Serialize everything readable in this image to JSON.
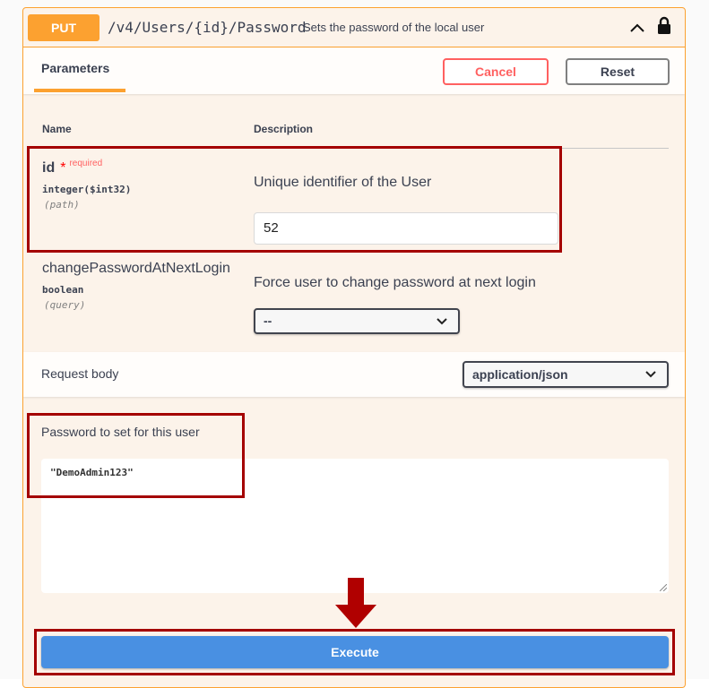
{
  "operation": {
    "method": "PUT",
    "path": "/v4/Users/{id}/Password",
    "summary": "Sets the password of the local user"
  },
  "tabs": {
    "parameters": "Parameters"
  },
  "buttons": {
    "cancel": "Cancel",
    "reset": "Reset",
    "execute": "Execute"
  },
  "table": {
    "col_name": "Name",
    "col_description": "Description"
  },
  "params": [
    {
      "name": "id",
      "required_mark": "*",
      "required_label": "required",
      "type": "integer($int32)",
      "in": "(path)",
      "description": "Unique identifier of the User",
      "value": "52"
    },
    {
      "name": "changePasswordAtNextLogin",
      "type": "boolean",
      "in": "(query)",
      "description": "Force user to change password at next login",
      "selected": "--"
    }
  ],
  "request_body": {
    "label": "Request body",
    "content_type": "application/json",
    "description": "Password to set for this user",
    "value": "\"DemoAdmin123\""
  },
  "colors": {
    "method_put": "#fca130",
    "cancel": "#ff6060",
    "execute": "#4990e2",
    "highlight": "#a40000"
  }
}
